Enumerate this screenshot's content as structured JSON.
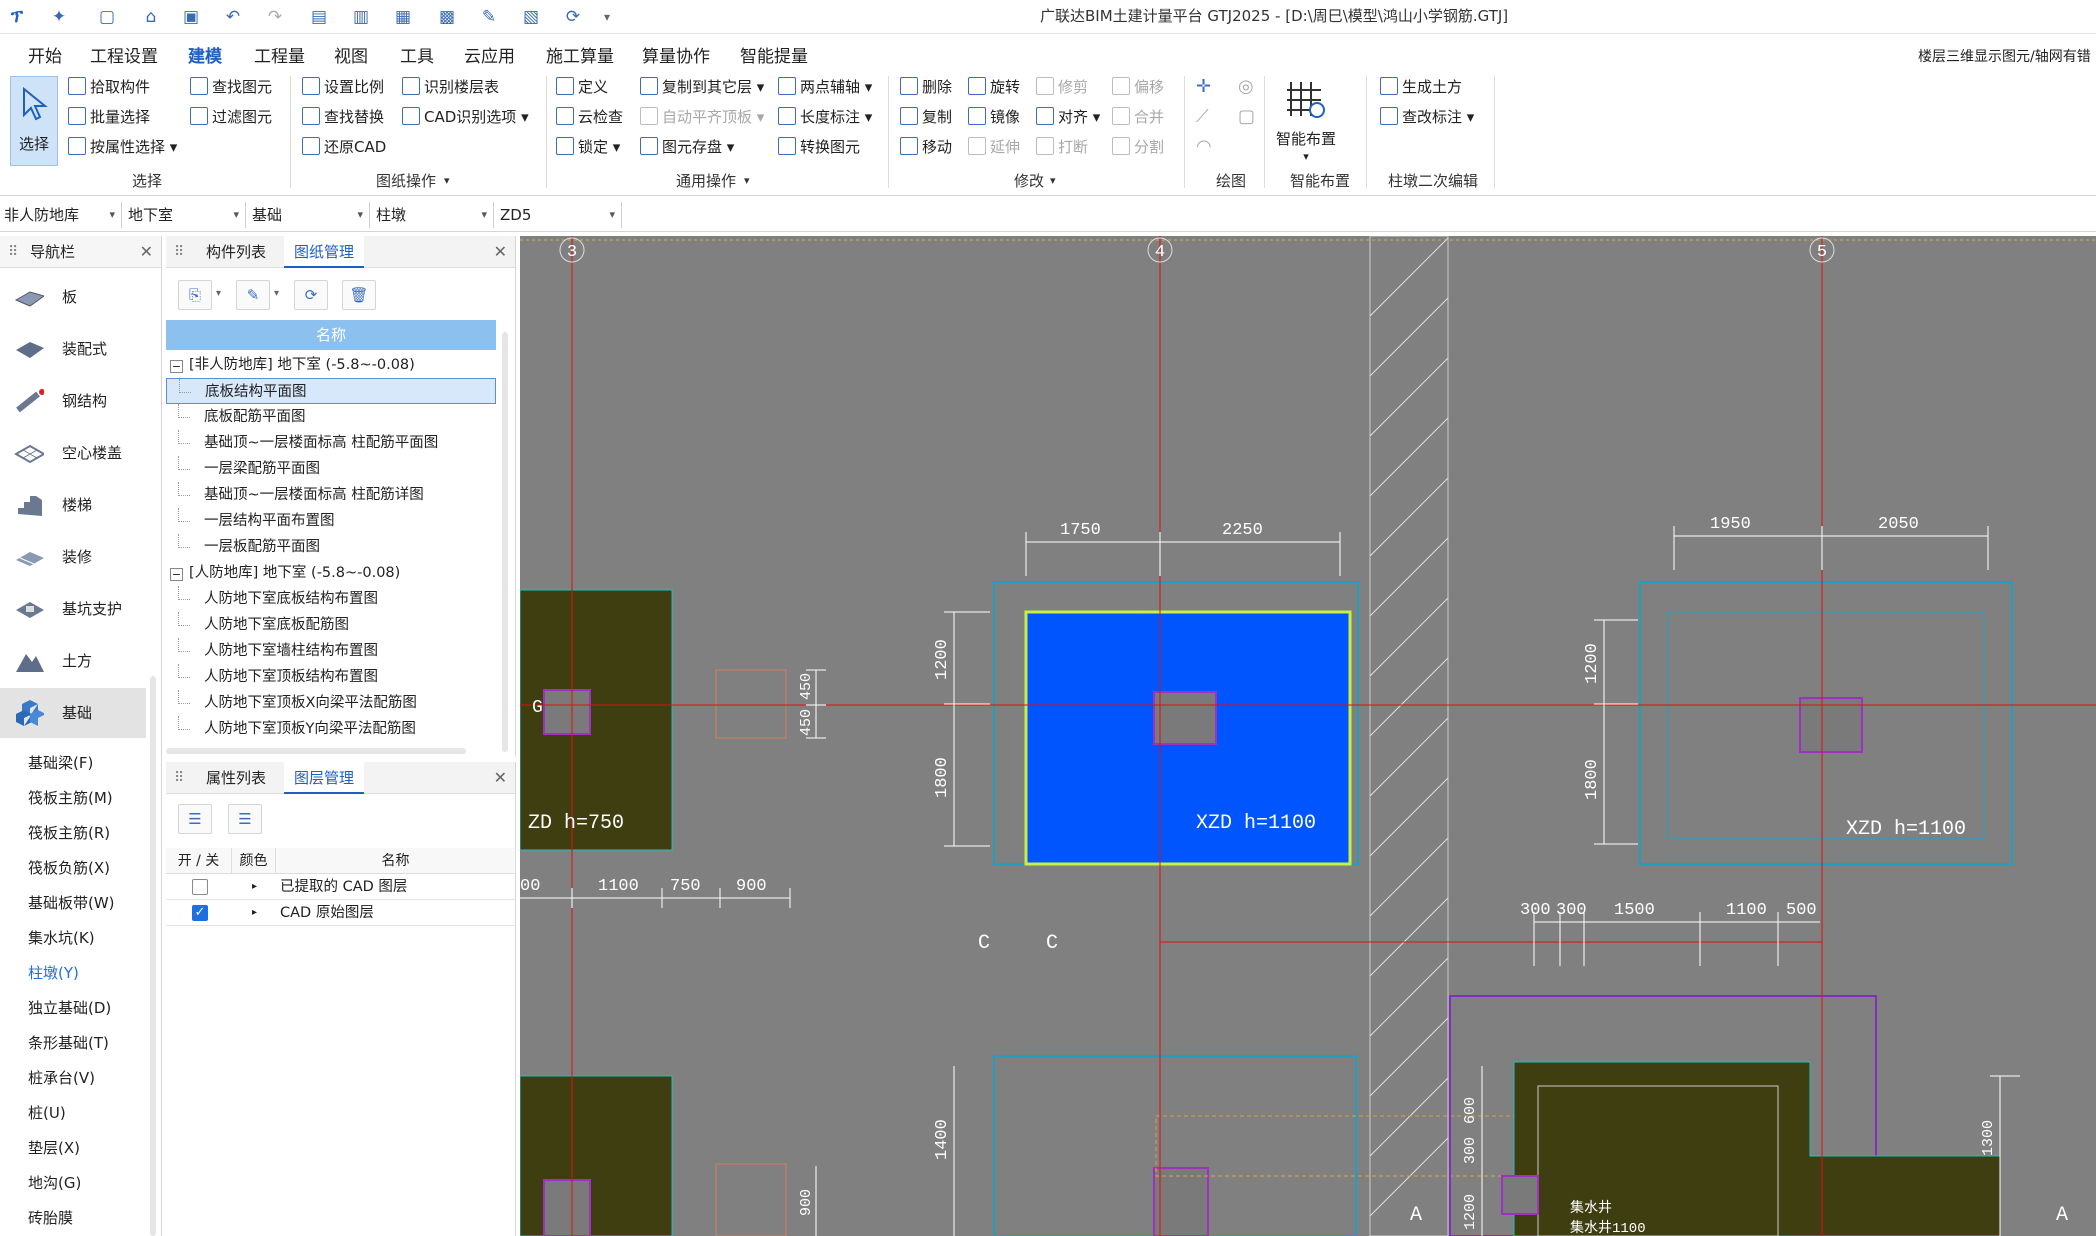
{
  "window": {
    "title": "广联达BIM土建计量平台 GTJ2025 - [D:\\周巳\\模型\\鸿山小学钢筋.GTJ]"
  },
  "menus": [
    "开始",
    "工程设置",
    "建模",
    "工程量",
    "视图",
    "工具",
    "云应用",
    "施工算量",
    "算量协作",
    "智能提量"
  ],
  "menu_right": "楼层三维显示图元/轴网有错",
  "ribbon": {
    "select": {
      "label": "选择",
      "pick": "拾取构件",
      "batch": "批量选择",
      "by_attr": "按属性选择",
      "find": "查找图元",
      "filter": "过滤图元",
      "group": "选择"
    },
    "drawing_ops": {
      "scale": "设置比例",
      "find_replace": "查找替换",
      "restore": "还原CAD",
      "recog_floor": "识别楼层表",
      "cad_options": "CAD识别选项",
      "group": "图纸操作"
    },
    "common_ops": {
      "define": "定义",
      "cloud_check": "云检查",
      "lock": "锁定",
      "copy_to": "复制到其它层",
      "auto_flat": "自动平齐顶板",
      "save_elem": "图元存盘",
      "two_point": "两点辅轴",
      "length_mark": "长度标注",
      "convert": "转换图元",
      "group": "通用操作"
    },
    "modify": {
      "delete": "删除",
      "copy": "复制",
      "move": "移动",
      "rotate": "旋转",
      "mirror": "镜像",
      "extend": "延伸",
      "trim": "修剪",
      "align": "对齐",
      "break": "打断",
      "offset": "偏移",
      "merge": "合并",
      "split": "分割",
      "group": "修改"
    },
    "draw": {
      "group": "绘图"
    },
    "smart": {
      "label": "智能布置",
      "group": "智能布置"
    },
    "pier_edit": {
      "gen_earth": "生成土方",
      "check_mark": "查改标注",
      "group": "柱墩二次编辑"
    }
  },
  "filters": [
    "非人防地库",
    "地下室",
    "基础",
    "柱墩",
    "ZD5"
  ],
  "nav": {
    "title": "导航栏",
    "items": [
      "板",
      "装配式",
      "钢结构",
      "空心楼盖",
      "楼梯",
      "装修",
      "基坑支护",
      "土方",
      "基础"
    ],
    "sub": [
      "基础梁(F)",
      "筏板主筋(M)",
      "筏板主筋(R)",
      "筏板负筋(X)",
      "基础板带(W)",
      "集水坑(K)",
      "柱墩(Y)",
      "独立基础(D)",
      "条形基础(T)",
      "桩承台(V)",
      "桩(U)",
      "垫层(X)",
      "地沟(G)",
      "砖胎膜"
    ]
  },
  "drawings": {
    "tabs": [
      "构件列表",
      "图纸管理"
    ],
    "header": "名称",
    "group1": "[非人防地库] 地下室 (-5.8~-0.08)",
    "items1": [
      "底板结构平面图",
      "底板配筋平面图",
      "基础顶~一层楼面标高 柱配筋平面图",
      "一层梁配筋平面图",
      "基础顶~一层楼面标高 柱配筋详图",
      "一层结构平面布置图",
      "一层板配筋平面图"
    ],
    "group2": "[人防地库] 地下室 (-5.8~-0.08)",
    "items2": [
      "人防地下室底板结构布置图",
      "人防地下室底板配筋图",
      "人防地下室墙柱结构布置图",
      "人防地下室顶板结构布置图",
      "人防地下室顶板X向梁平法配筋图",
      "人防地下室顶板Y向梁平法配筋图"
    ]
  },
  "layers": {
    "tabs": [
      "属性列表",
      "图层管理"
    ],
    "head": [
      "开 / 关",
      "颜色",
      "名称"
    ],
    "rows": [
      "已提取的 CAD 图层",
      "CAD 原始图层"
    ]
  },
  "cad": {
    "axes": [
      "3",
      "4",
      "5"
    ],
    "dims_top1": [
      "1750",
      "2250"
    ],
    "dims_top2": [
      "1950",
      "2050"
    ],
    "dims_v": [
      "1200",
      "1800"
    ],
    "dims_v2": [
      "1200",
      "1800"
    ],
    "dims_bot": [
      "1100",
      "750",
      "900"
    ],
    "dims_right": [
      "300",
      "300",
      "1500",
      "1100",
      "500"
    ],
    "dim_450": "450",
    "dim_450b": "450",
    "dim_1400": "1400",
    "dim_900": "900",
    "dim_600": "600",
    "dim_300": "300",
    "dim_1200b": "1200",
    "dim_1300": "1300",
    "label_xzd1": "XZD  h=1100",
    "label_xzd2": "XZD  h=1100",
    "label_zd": "ZD  h=750",
    "g": "G",
    "c1": "C",
    "c2": "C",
    "a1": "A",
    "a2": "A",
    "dim_100": "00",
    "pit_text": "集水井",
    "pit_text2": "集水井1100"
  },
  "colors": {
    "accent": "#1f5fbf",
    "canvas": "#808080",
    "selected_fill": "#0055ff"
  }
}
